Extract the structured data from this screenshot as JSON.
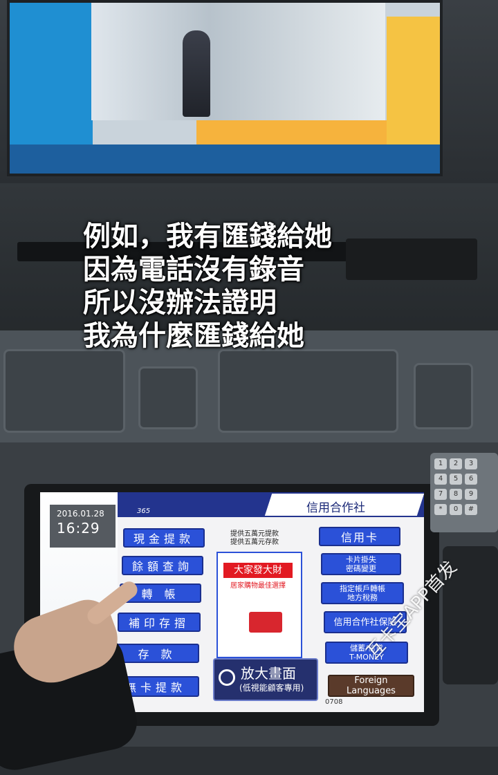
{
  "caption": {
    "lines": [
      "例如，我有匯錢給她",
      "因為電話沒有錄音",
      "所以沒辦法證明",
      "我為什麼匯錢給她"
    ]
  },
  "atm_screen": {
    "date": "2016.01.28",
    "time": "16:29",
    "logo": "365",
    "title": "信用合作社",
    "left_buttons": [
      "現金提款",
      "餘額查詢",
      "轉 帳",
      "補印存摺",
      "存 款",
      "無卡提款"
    ],
    "right_buttons": [
      {
        "label": "信用卡"
      },
      {
        "label": "卡片掛失\n密碼變更"
      },
      {
        "label": "指定帳戶轉帳\n地方稅務"
      },
      {
        "label": "信用合作社保險"
      },
      {
        "label": "儲蓄/信貸\nT-MONEY"
      },
      {
        "label": "Foreign Languages"
      }
    ],
    "promo": {
      "top_lines": "提供五萬元提款\n提供五萬元存款",
      "headline": "大家發大財",
      "subline": "居家購物最佳選擇"
    },
    "zoom": {
      "label": "放大畫面",
      "sub": "(低視能顧客專用)"
    },
    "footer": "0708"
  },
  "keypad": {
    "keys": [
      "1",
      "2",
      "3",
      "4",
      "5",
      "6",
      "7",
      "8",
      "9",
      "*",
      "0",
      "#"
    ]
  },
  "watermark": "互卡宝APP首发",
  "colors": {
    "button_blue": "#2b51d8",
    "header_navy": "#23348e",
    "promo_red": "#e21a22"
  }
}
